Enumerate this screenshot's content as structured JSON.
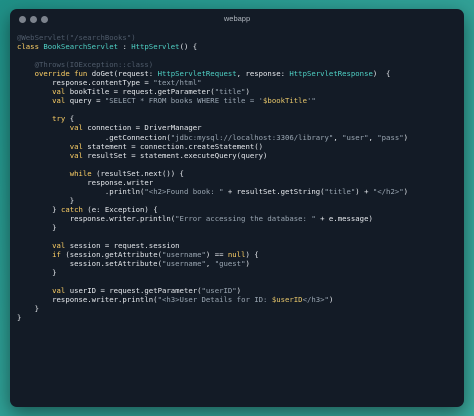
{
  "window": {
    "title": "webapp",
    "controls": [
      "close",
      "minimize",
      "maximize"
    ]
  },
  "colors": {
    "keyword": "#ffd166",
    "type": "#4fd1c5",
    "string": "#9aa6b2",
    "annotation": "#4f5b6a",
    "text": "#e6e9ed"
  },
  "code_lines": [
    [
      [
        "ann",
        "@WebServlet(\"/searchBooks\")"
      ]
    ],
    [
      [
        "kw",
        "class "
      ],
      [
        "ty",
        "BookSearchServlet"
      ],
      [
        "plain",
        " : "
      ],
      [
        "ty",
        "HttpServlet"
      ],
      [
        "plain",
        "() {"
      ]
    ],
    [],
    [
      [
        "ann",
        "    @Throws(IOException::class)"
      ]
    ],
    [
      [
        "kw",
        "    override fun "
      ],
      [
        "plain",
        "doGet(request: "
      ],
      [
        "ty",
        "HttpServletRequest"
      ],
      [
        "plain",
        ", response: "
      ],
      [
        "ty",
        "HttpServletResponse"
      ],
      [
        "plain",
        ")  {"
      ]
    ],
    [
      [
        "plain",
        "        response.contentType = "
      ],
      [
        "str",
        "\"text/html\""
      ]
    ],
    [
      [
        "kw",
        "        val "
      ],
      [
        "plain",
        "bookTitle = request.getParameter("
      ],
      [
        "str",
        "\"title\""
      ],
      [
        "plain",
        ")"
      ]
    ],
    [
      [
        "kw",
        "        val "
      ],
      [
        "plain",
        "query = "
      ],
      [
        "str",
        "\"SELECT * FROM books WHERE title = '"
      ],
      [
        "var",
        "$bookTitle"
      ],
      [
        "str",
        "'\""
      ]
    ],
    [],
    [
      [
        "kw",
        "        try "
      ],
      [
        "plain",
        "{"
      ]
    ],
    [
      [
        "kw",
        "            val "
      ],
      [
        "plain",
        "connection = DriverManager"
      ]
    ],
    [
      [
        "plain",
        "                    .getConnection("
      ],
      [
        "str",
        "\"jdbc:mysql://localhost:3306/library\""
      ],
      [
        "plain",
        ", "
      ],
      [
        "str",
        "\"user\""
      ],
      [
        "plain",
        ", "
      ],
      [
        "str",
        "\"pass\""
      ],
      [
        "plain",
        ")"
      ]
    ],
    [
      [
        "kw",
        "            val "
      ],
      [
        "plain",
        "statement = connection.createStatement()"
      ]
    ],
    [
      [
        "kw",
        "            val "
      ],
      [
        "plain",
        "resultSet = statement.executeQuery(query)"
      ]
    ],
    [],
    [
      [
        "kw",
        "            while "
      ],
      [
        "plain",
        "(resultSet.next()) {"
      ]
    ],
    [
      [
        "plain",
        "                response.writer"
      ]
    ],
    [
      [
        "plain",
        "                    .println("
      ],
      [
        "str",
        "\"<h2>Found book: \""
      ],
      [
        "plain",
        " + resultSet.getString("
      ],
      [
        "str",
        "\"title\""
      ],
      [
        "plain",
        ") + "
      ],
      [
        "str",
        "\"</h2>\""
      ],
      [
        "plain",
        ")"
      ]
    ],
    [
      [
        "plain",
        "            }"
      ]
    ],
    [
      [
        "plain",
        "        } "
      ],
      [
        "kw",
        "catch "
      ],
      [
        "plain",
        "(e: Exception) {"
      ]
    ],
    [
      [
        "plain",
        "            response.writer.println("
      ],
      [
        "str",
        "\"Error accessing the database: \""
      ],
      [
        "plain",
        " + e.message)"
      ]
    ],
    [
      [
        "plain",
        "        }"
      ]
    ],
    [],
    [
      [
        "kw",
        "        val "
      ],
      [
        "plain",
        "session = request.session"
      ]
    ],
    [
      [
        "kw",
        "        if "
      ],
      [
        "plain",
        "(session.getAttribute("
      ],
      [
        "str",
        "\"username\""
      ],
      [
        "plain",
        ") == "
      ],
      [
        "kw",
        "null"
      ],
      [
        "plain",
        ") {"
      ]
    ],
    [
      [
        "plain",
        "            session.setAttribute("
      ],
      [
        "str",
        "\"username\""
      ],
      [
        "plain",
        ", "
      ],
      [
        "str",
        "\"guest\""
      ],
      [
        "plain",
        ")"
      ]
    ],
    [
      [
        "plain",
        "        }"
      ]
    ],
    [],
    [
      [
        "kw",
        "        val "
      ],
      [
        "plain",
        "userID = request.getParameter("
      ],
      [
        "str",
        "\"userID\""
      ],
      [
        "plain",
        ")"
      ]
    ],
    [
      [
        "plain",
        "        response.writer.println("
      ],
      [
        "str",
        "\"<h3>User Details for ID: "
      ],
      [
        "var",
        "$userID"
      ],
      [
        "str",
        "</h3>\""
      ],
      [
        "plain",
        ")"
      ]
    ],
    [
      [
        "plain",
        "    }"
      ]
    ],
    [
      [
        "plain",
        "}"
      ]
    ]
  ]
}
